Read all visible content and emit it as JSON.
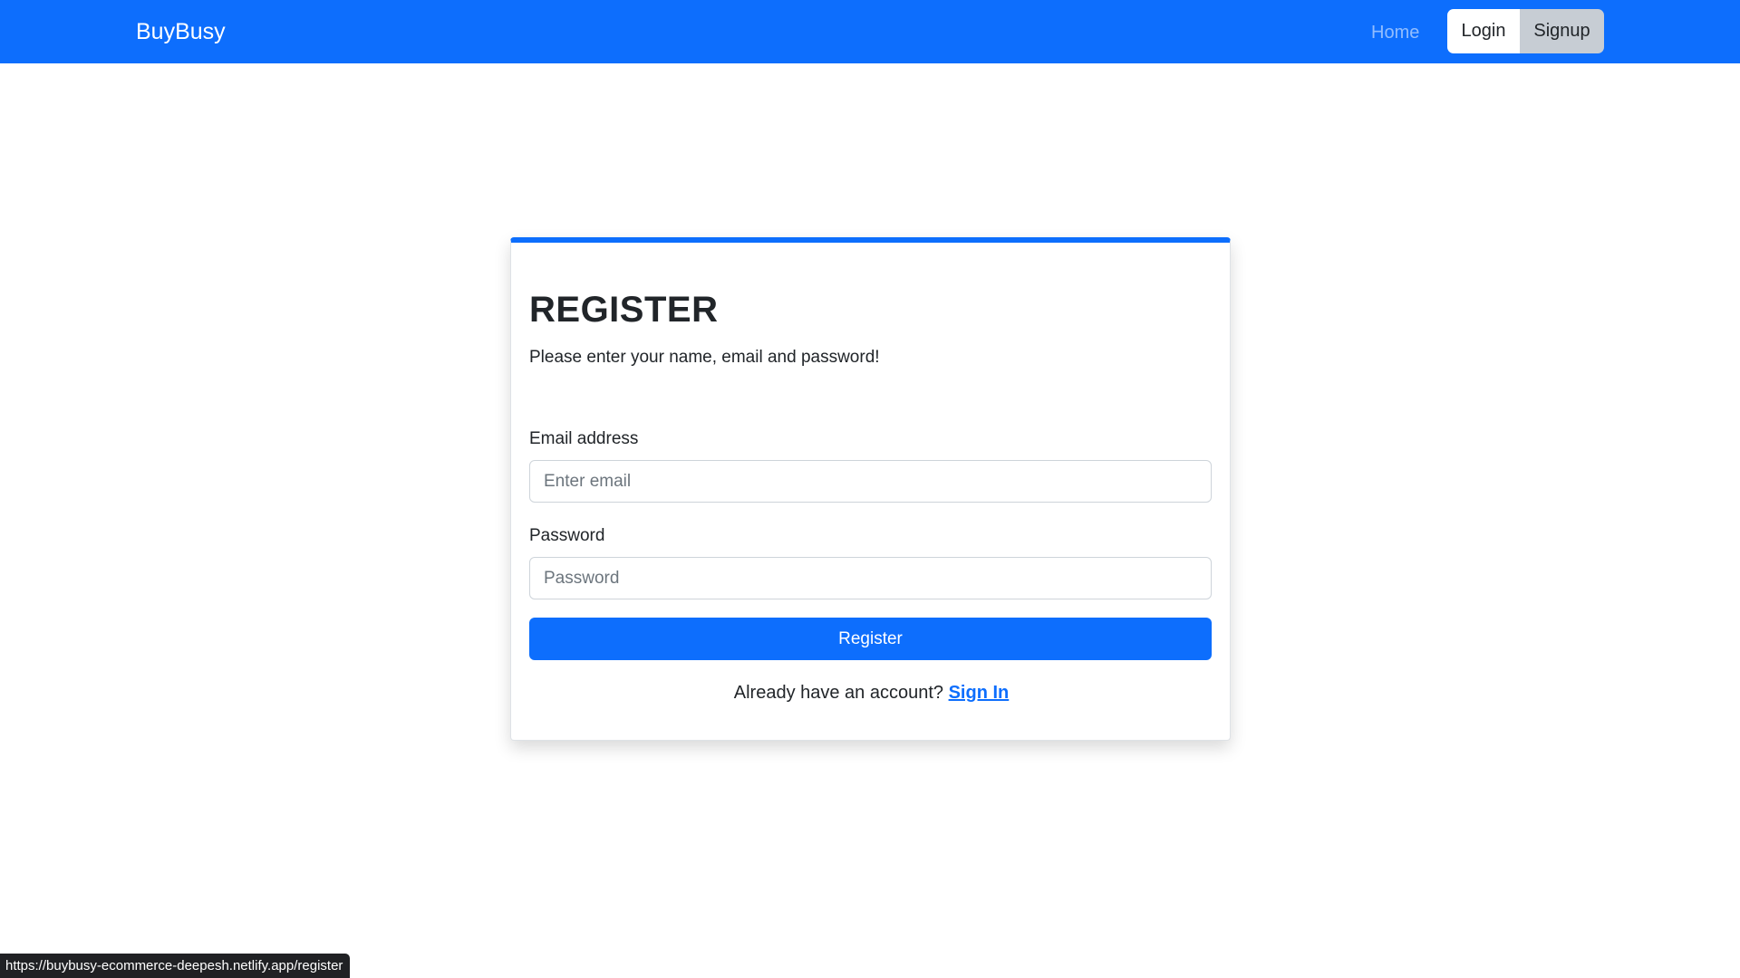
{
  "navbar": {
    "brand": "BuyBusy",
    "home_label": "Home",
    "login_label": "Login",
    "signup_label": "Signup",
    "background_color": "#0d6efd"
  },
  "card": {
    "title": "REGISTER",
    "subtitle": "Please enter your name, email and password!",
    "email_label": "Email address",
    "email_placeholder": "Enter email",
    "email_value": "",
    "password_label": "Password",
    "password_placeholder": "Password",
    "password_value": "",
    "register_button": "Register",
    "signin_prompt": "Already have an account? ",
    "signin_link": "Sign In",
    "accent_color": "#0d6efd"
  },
  "status_bar": {
    "url": "https://buybusy-ecommerce-deepesh.netlify.app/register"
  }
}
